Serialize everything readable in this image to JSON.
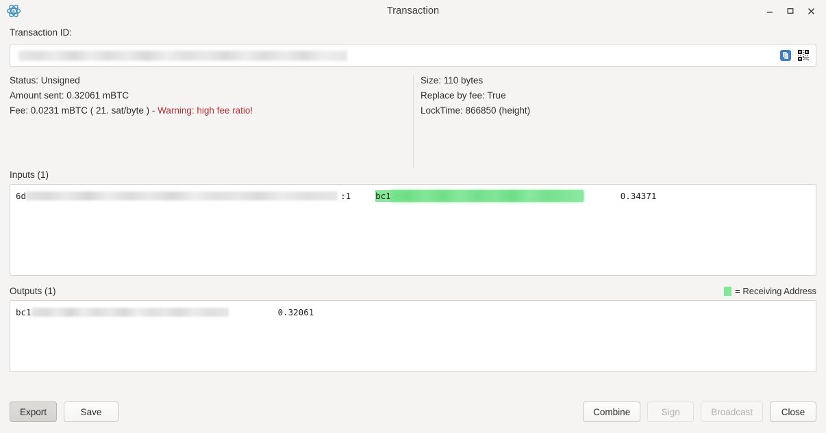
{
  "window": {
    "title": "Transaction",
    "app_icon": "electrum-logo-icon",
    "controls": {
      "minimize": "minimize-icon",
      "maximize": "maximize-icon",
      "close": "close-icon"
    }
  },
  "txid": {
    "label": "Transaction ID:",
    "value": "",
    "redacted": true,
    "copy_icon": "copy-icon",
    "qr_icon": "qr-code-icon"
  },
  "info": {
    "left": [
      {
        "label": "Status:",
        "value": "Unsigned",
        "text": "Status: Unsigned"
      },
      {
        "label": "Amount sent:",
        "value": "0.32061 mBTC",
        "text": "Amount sent: 0.32061 mBTC"
      },
      {
        "label": "Fee:",
        "value": "0.0231 mBTC ( 21. sat/byte )",
        "text": "Fee: 0.0231 mBTC ( 21. sat/byte ) - ",
        "warning": "Warning: high fee ratio!"
      }
    ],
    "right": [
      {
        "text": "Size: 110 bytes"
      },
      {
        "text": "Replace by fee: True"
      },
      {
        "text": "LockTime: 866850 (height)"
      }
    ]
  },
  "inputs": {
    "heading": "Inputs (1)",
    "rows": [
      {
        "txid_prefix": "6d",
        "txid_redacted": true,
        "output_index": ":1",
        "address_prefix": "bc1",
        "address_redacted": true,
        "is_receiving": true,
        "amount": "0.34371"
      }
    ]
  },
  "outputs": {
    "heading": "Outputs (1)",
    "legend": "= Receiving Address",
    "legend_color": "#86e79a",
    "rows": [
      {
        "address_prefix": "bc1",
        "address_redacted": true,
        "is_receiving": false,
        "amount": "0.32061"
      }
    ]
  },
  "footer": {
    "export": "Export",
    "save": "Save",
    "combine": "Combine",
    "sign": "Sign",
    "broadcast": "Broadcast",
    "close": "Close"
  },
  "colors": {
    "background": "#f5f4f2",
    "warning": "#b03232",
    "receiving_green": "#86e79a",
    "accent_blue": "#3f7fbf"
  }
}
